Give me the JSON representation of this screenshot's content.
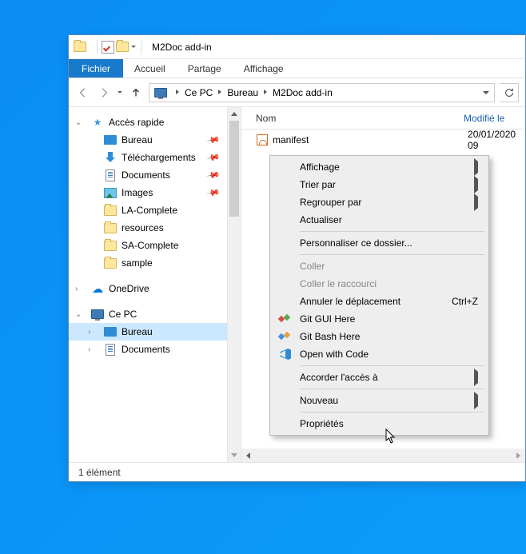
{
  "window": {
    "title": "M2Doc add-in"
  },
  "ribbon": {
    "file": "Fichier",
    "tabs": [
      "Accueil",
      "Partage",
      "Affichage"
    ]
  },
  "breadcrumb": [
    "Ce PC",
    "Bureau",
    "M2Doc add-in"
  ],
  "columns": {
    "name": "Nom",
    "modified": "Modifié le"
  },
  "sidebar": {
    "quick_access": "Accès rapide",
    "items": [
      {
        "label": "Bureau",
        "pin": true,
        "icon": "desktop"
      },
      {
        "label": "Téléchargements",
        "pin": true,
        "icon": "download"
      },
      {
        "label": "Documents",
        "pin": true,
        "icon": "document"
      },
      {
        "label": "Images",
        "pin": true,
        "icon": "image"
      },
      {
        "label": "LA-Complete",
        "pin": false,
        "icon": "folder"
      },
      {
        "label": "resources",
        "pin": false,
        "icon": "folder"
      },
      {
        "label": "SA-Complete",
        "pin": false,
        "icon": "folder"
      },
      {
        "label": "sample",
        "pin": false,
        "icon": "folder"
      }
    ],
    "onedrive": "OneDrive",
    "this_pc": "Ce PC",
    "pc_items": [
      {
        "label": "Bureau",
        "icon": "desktop",
        "selected": true
      },
      {
        "label": "Documents",
        "icon": "document",
        "selected": false
      }
    ]
  },
  "files": [
    {
      "name": "manifest",
      "date": "20/01/2020 09"
    }
  ],
  "statusbar": {
    "count": "1 élément"
  },
  "context_menu": {
    "view": "Affichage",
    "sort": "Trier par",
    "group": "Regrouper par",
    "refresh": "Actualiser",
    "customize": "Personnaliser ce dossier...",
    "paste": "Coller",
    "paste_shortcut": "Coller le raccourci",
    "undo_move": "Annuler le déplacement",
    "undo_shortcut": "Ctrl+Z",
    "git_gui": "Git GUI Here",
    "git_bash": "Git Bash Here",
    "open_code": "Open with Code",
    "grant_access": "Accorder l'accès à",
    "new": "Nouveau",
    "properties": "Propriétés"
  }
}
